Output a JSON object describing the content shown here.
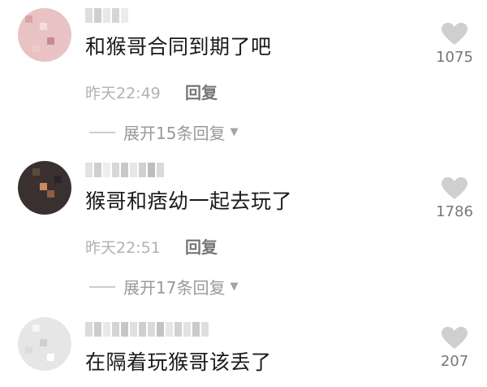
{
  "comments": [
    {
      "text": "和猴哥合同到期了吧",
      "time": "昨天22:49",
      "reply_label": "回复",
      "expand_label": "展开15条回复",
      "likes": "1075",
      "avatar_colors": [
        "#e9c3c3",
        "#d9a3a5",
        "#f2dede",
        "#c28b93"
      ]
    },
    {
      "text": "猴哥和痞幼一起去玩了",
      "time": "昨天22:51",
      "reply_label": "回复",
      "expand_label": "展开17条回复",
      "likes": "1786",
      "avatar_colors": [
        "#3b3030",
        "#8a5e45",
        "#c98a5d",
        "#5a4a3e"
      ]
    },
    {
      "text": "在隔着玩猴哥该丢了",
      "likes": "207",
      "avatar_colors": [
        "#e6e6e6",
        "#f5f5f5",
        "#d0d0d0",
        "#ffffff"
      ]
    }
  ],
  "icons": {
    "like": "heart-icon",
    "expand": "caret-down-icon"
  },
  "colors": {
    "text": "#1a1a1a",
    "meta": "#b2b2b2",
    "heart": "#cfcfcf"
  }
}
